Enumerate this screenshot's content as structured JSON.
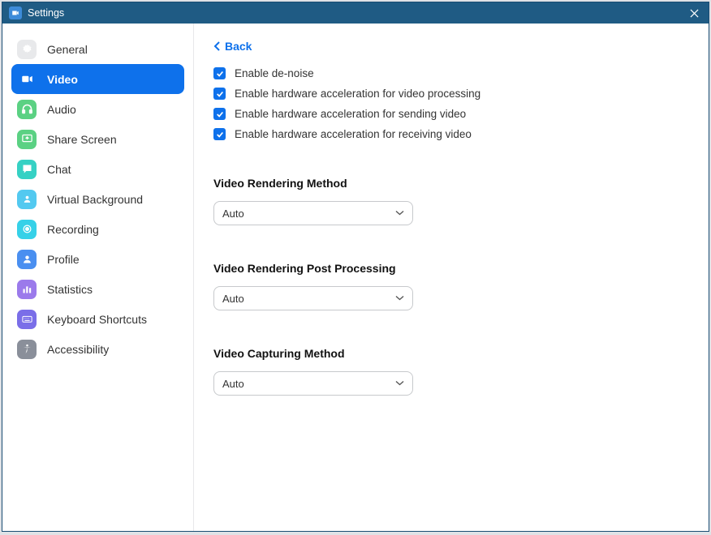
{
  "window": {
    "title": "Settings"
  },
  "sidebar": {
    "items": [
      {
        "label": "General"
      },
      {
        "label": "Video"
      },
      {
        "label": "Audio"
      },
      {
        "label": "Share Screen"
      },
      {
        "label": "Chat"
      },
      {
        "label": "Virtual Background"
      },
      {
        "label": "Recording"
      },
      {
        "label": "Profile"
      },
      {
        "label": "Statistics"
      },
      {
        "label": "Keyboard Shortcuts"
      },
      {
        "label": "Accessibility"
      }
    ]
  },
  "content": {
    "back_label": "Back",
    "checkboxes": [
      {
        "label": "Enable de-noise",
        "checked": true
      },
      {
        "label": "Enable hardware acceleration for video processing",
        "checked": true
      },
      {
        "label": "Enable hardware acceleration for sending video",
        "checked": true
      },
      {
        "label": "Enable hardware acceleration for receiving video",
        "checked": true
      }
    ],
    "sections": [
      {
        "title": "Video Rendering Method",
        "value": "Auto"
      },
      {
        "title": "Video Rendering Post Processing",
        "value": "Auto"
      },
      {
        "title": "Video Capturing Method",
        "value": "Auto"
      }
    ]
  }
}
